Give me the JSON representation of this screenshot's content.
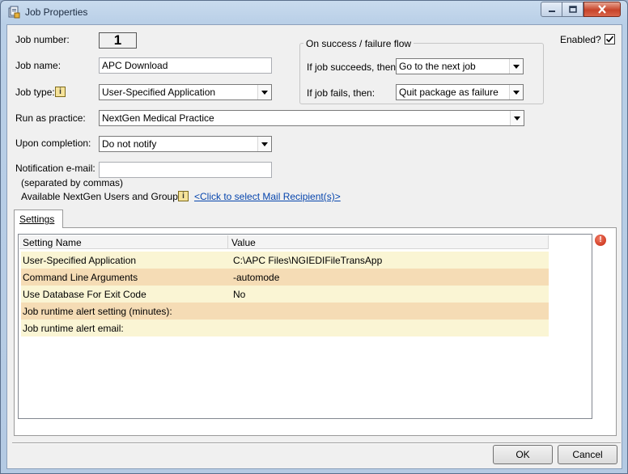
{
  "window": {
    "title": "Job Properties",
    "title_icon": "job-properties-icon",
    "controls": [
      "minimize-icon",
      "maximize-icon",
      "close-icon"
    ]
  },
  "job": {
    "number_label": "Job number:",
    "number": "1",
    "name_label": "Job name:",
    "name": "APC Download",
    "type_label": "Job type:",
    "type_info": "i",
    "type_value": "User-Specified Application",
    "practice_label": "Run as practice:",
    "practice_value": "NextGen Medical Practice",
    "completion_label": "Upon completion:",
    "completion_value": "Do not notify",
    "email_label": "Notification e-mail:",
    "email_value": "",
    "email_hint": "(separated by commas)",
    "available_label": "Available NextGen Users and Groups:",
    "available_info": "i",
    "mail_link": "<Click to select Mail Recipient(s)>",
    "enabled_label": "Enabled?",
    "enabled": true
  },
  "flow": {
    "legend": "On success / failure flow",
    "succeeds_label": "If job succeeds, then:",
    "succeeds_value": "Go to the next job",
    "fails_label": "If job fails, then:",
    "fails_value": "Quit package as failure"
  },
  "tabs": [
    {
      "label": "Settings",
      "selected": true
    }
  ],
  "settings": {
    "columns": [
      "Setting Name",
      "Value"
    ],
    "rows": [
      {
        "name": "User-Specified Application",
        "value": "C:\\APC Files\\NGIEDIFileTransApp"
      },
      {
        "name": "Command Line Arguments",
        "value": "-automode"
      },
      {
        "name": "Use Database For Exit Code",
        "value": "No"
      },
      {
        "name": "Job runtime alert setting (minutes):",
        "value": ""
      },
      {
        "name": "Job runtime alert email:",
        "value": ""
      }
    ],
    "status_icon": "error-icon"
  },
  "buttons": {
    "ok": "OK",
    "cancel": "Cancel"
  }
}
